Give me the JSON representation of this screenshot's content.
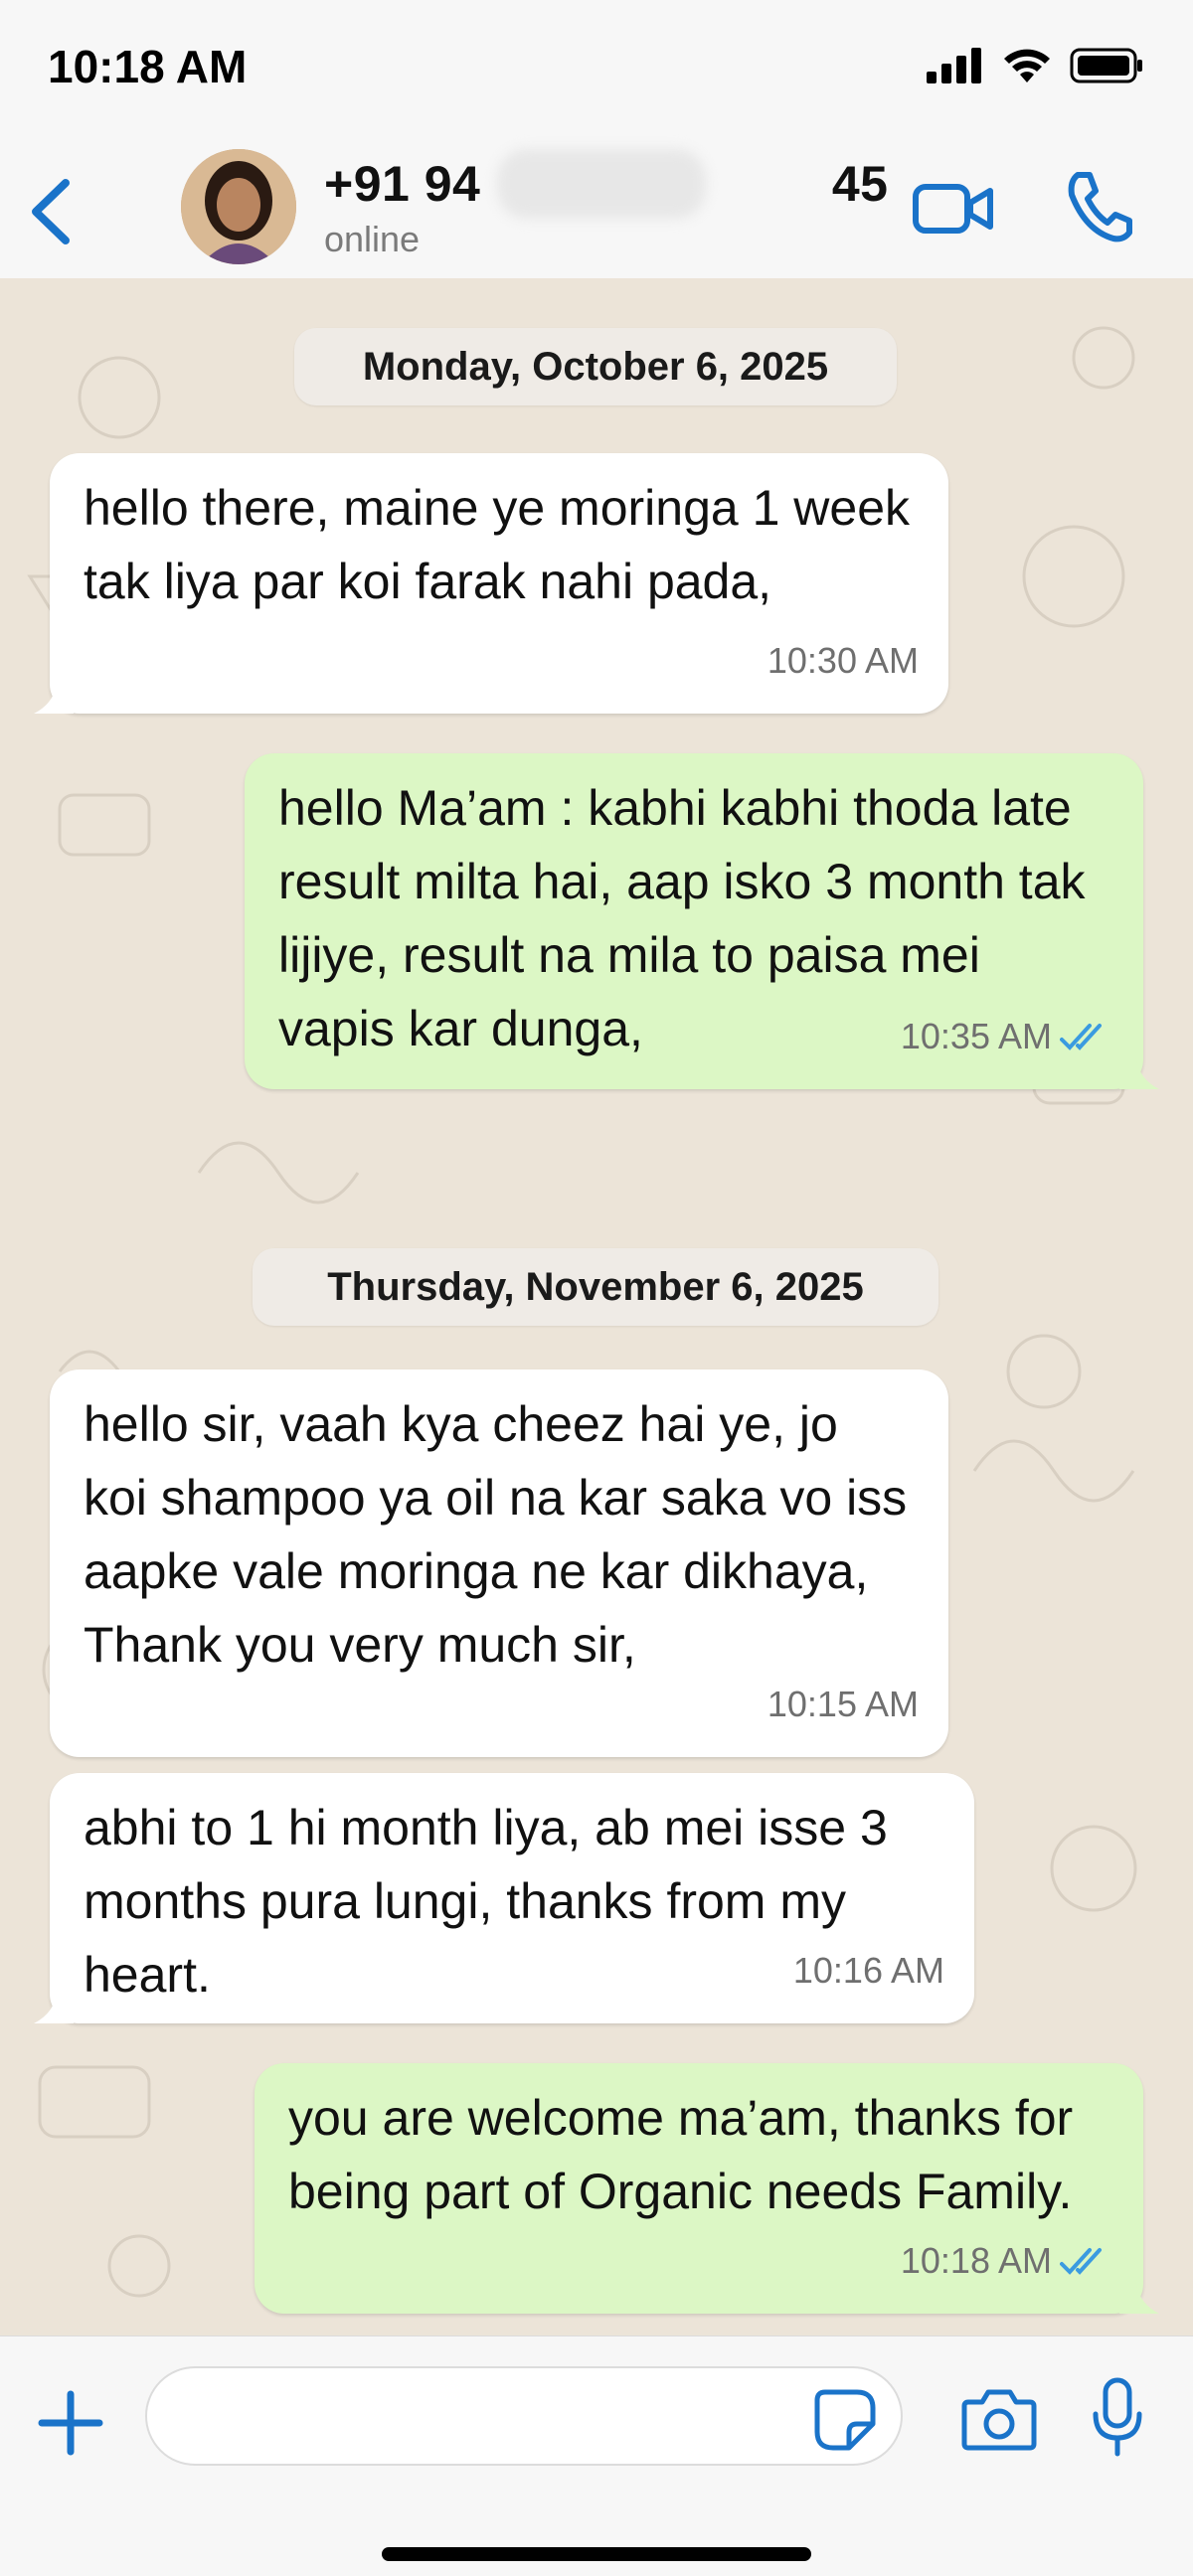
{
  "status_bar": {
    "time": "10:18 AM"
  },
  "header": {
    "contact_name": "+91 94       45",
    "presence": "online"
  },
  "messages": [
    {
      "type": "date",
      "text": "Monday, October 6, 2025"
    },
    {
      "type": "incoming",
      "text": "hello there, maine ye moringa 1 week tak liya par koi farak nahi pada,",
      "time": "10:30 AM"
    },
    {
      "type": "outgoing",
      "text": "hello Ma’am : kabhi kabhi thoda late result milta hai, aap isko 3 month tak lijiye, result na mila to paisa mei vapis kar dunga,",
      "time": "10:35 AM",
      "status": "read"
    },
    {
      "type": "date",
      "text": "Thursday, November 6, 2025"
    },
    {
      "type": "incoming",
      "text": "hello sir, vaah kya cheez hai ye, jo koi shampoo ya oil na kar saka vo iss aapke vale moringa ne kar dikhaya, Thank you very much sir,",
      "time": "10:15 AM"
    },
    {
      "type": "incoming",
      "text": "abhi to 1 hi month liya, ab mei isse 3 months pura lungi, thanks from my heart.",
      "time": "10:16 AM"
    },
    {
      "type": "outgoing",
      "text": "you are welcome ma’am, thanks for being part of Organic needs Family.",
      "time": "10:18 AM",
      "status": "read"
    }
  ],
  "input": {
    "placeholder": ""
  },
  "colors": {
    "accent": "#1a73c9",
    "outgoing_bubble": "#dcf7c5",
    "incoming_bubble": "#ffffff",
    "chat_background": "#ece4d8",
    "read_ticks": "#3b9be0"
  },
  "icons": [
    "back-chevron-icon",
    "video-call-icon",
    "voice-call-icon",
    "plus-icon",
    "sticker-icon",
    "camera-icon",
    "mic-icon",
    "read-ticks-icon",
    "signal-icon",
    "wifi-icon",
    "battery-icon"
  ]
}
